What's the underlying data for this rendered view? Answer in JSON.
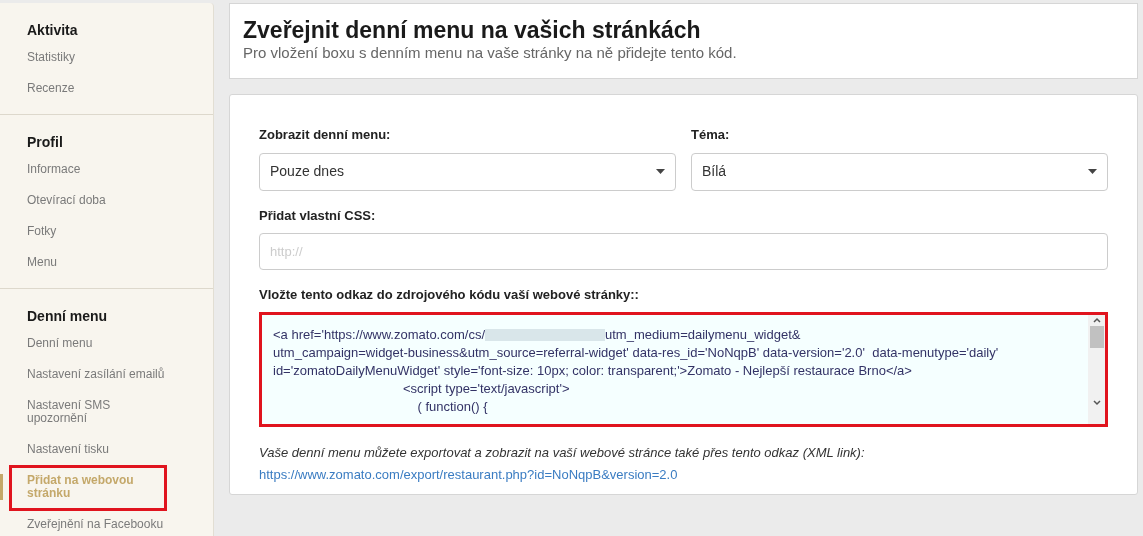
{
  "sidebar": {
    "sections": [
      {
        "title": "Aktivita",
        "items": [
          {
            "label": "Statistiky",
            "selected": false,
            "highlighted": false
          },
          {
            "label": "Recenze",
            "selected": false,
            "highlighted": false
          }
        ]
      },
      {
        "title": "Profil",
        "items": [
          {
            "label": "Informace",
            "selected": false,
            "highlighted": false
          },
          {
            "label": "Otevírací doba",
            "selected": false,
            "highlighted": false
          },
          {
            "label": "Fotky",
            "selected": false,
            "highlighted": false
          },
          {
            "label": "Menu",
            "selected": false,
            "highlighted": false
          }
        ]
      },
      {
        "title": "Denní menu",
        "items": [
          {
            "label": "Denní menu",
            "selected": false,
            "highlighted": false
          },
          {
            "label": "Nastavení zasílání emailů",
            "selected": false,
            "highlighted": false
          },
          {
            "label": "Nastavení SMS upozornění",
            "selected": false,
            "highlighted": false
          },
          {
            "label": "Nastavení tisku",
            "selected": false,
            "highlighted": false
          },
          {
            "label": "Přidat na webovou stránku",
            "selected": true,
            "highlighted": true
          },
          {
            "label": "Zveřejnění na Facebooku",
            "selected": false,
            "highlighted": false
          }
        ]
      }
    ]
  },
  "header": {
    "title": "Zveřejnit denní menu na vašich stránkách",
    "subtitle": "Pro vložení boxu s denním menu na vaše stránky na ně přidejte tento kód."
  },
  "form": {
    "selects": [
      {
        "label": "Zobrazit denní menu:",
        "value": "Pouze dnes"
      },
      {
        "label": "Téma:",
        "value": "Bílá"
      }
    ],
    "css_field": {
      "label": "Přidat vlastní CSS:",
      "placeholder": "http://"
    },
    "code": {
      "label": "Vložte tento odkaz do zdrojového kódu vaší webové stránky::",
      "highlighted": true,
      "lines": [
        {
          "before": "<a href='https://www.zomato.com/cs/",
          "after": "utm_medium=dailymenu_widget&",
          "redacted": true
        },
        {
          "before": "utm_campaign=widget-business&utm_source=referral-widget' data-res_id='NoNqpB' data-version='2.0'  data-menutype='daily'",
          "redacted": false
        },
        {
          "before": "id='zomatoDailyMenuWidget' style='font-size: 10px; color: transparent;'>Zomato - Nejlepší restaurace Brno</a>",
          "redacted": false
        },
        {
          "before": "                                    <script type='text/javascript'>",
          "redacted": false
        },
        {
          "before": "                                        ( function() {",
          "redacted": false
        }
      ]
    },
    "export_note": "Vaše denní menu můžete exportovat a zobrazit na vaší webové stránce také přes tento odkaz (XML link):",
    "export_link": "https://www.zomato.com/export/restaurant.php?id=NoNqpB&version=2.0"
  }
}
